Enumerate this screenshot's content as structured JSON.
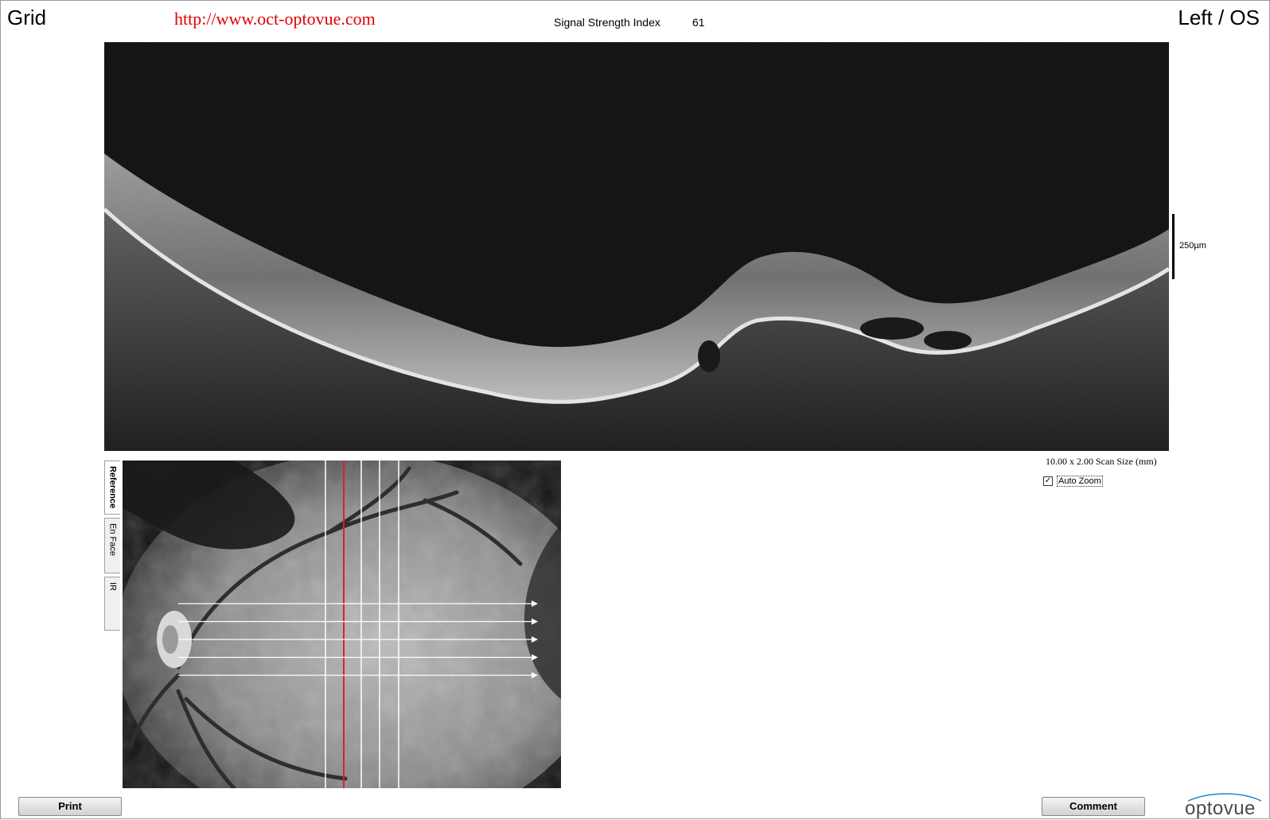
{
  "header": {
    "mode_title": "Grid",
    "website": "http://www.oct-optovue.com",
    "signal_strength_label": "Signal Strength Index",
    "signal_strength_value": "61",
    "eye": "Left / OS"
  },
  "bscan": {
    "scale_label": "250µm",
    "scan_size": "10.00 x 2.00 Scan Size (mm)"
  },
  "auto_zoom": {
    "label": "Auto Zoom",
    "checked": true,
    "check_glyph": "✓"
  },
  "tabs": [
    {
      "label": "Reference",
      "active": true
    },
    {
      "label": "En Face",
      "active": false
    },
    {
      "label": "IR",
      "active": false
    }
  ],
  "fundus": {
    "scan_line_count": 5,
    "red_line_color": "#e02020",
    "scan_line_color": "#ffffff"
  },
  "buttons": {
    "print": "Print",
    "comment": "Comment"
  },
  "brand": {
    "logo_text": "optovue",
    "logo_color": "#1e88c8"
  }
}
